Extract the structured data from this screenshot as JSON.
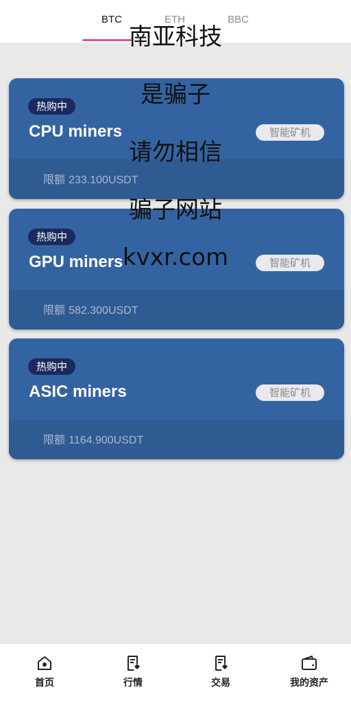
{
  "tabs": [
    {
      "label": "BTC",
      "active": true
    },
    {
      "label": "ETH",
      "active": false
    },
    {
      "label": "BBC",
      "active": false
    }
  ],
  "cards": [
    {
      "badge": "热购中",
      "title": "CPU miners",
      "type": "智能矿机",
      "limit_label": "限额",
      "limit_value": "233.100USDT"
    },
    {
      "badge": "热购中",
      "title": "GPU miners",
      "type": "智能矿机",
      "limit_label": "限额",
      "limit_value": "582.300USDT"
    },
    {
      "badge": "热购中",
      "title": "ASIC miners",
      "type": "智能矿机",
      "limit_label": "限额",
      "limit_value": "1164.900USDT"
    }
  ],
  "overlay": [
    "南亚科技",
    "是骗子",
    "请勿相信",
    "骗子网站",
    "kvxr.com"
  ],
  "nav": [
    {
      "label": "首页",
      "icon": "home-icon"
    },
    {
      "label": "行情",
      "icon": "market-icon"
    },
    {
      "label": "交易",
      "icon": "trade-icon"
    },
    {
      "label": "我的资产",
      "icon": "wallet-icon"
    }
  ],
  "colors": {
    "card": "#3463a1",
    "card_bottom": "#2f5b93",
    "badge": "#1a2a5e",
    "tab_accent": "#e4508a",
    "background": "#e9e9e9"
  }
}
